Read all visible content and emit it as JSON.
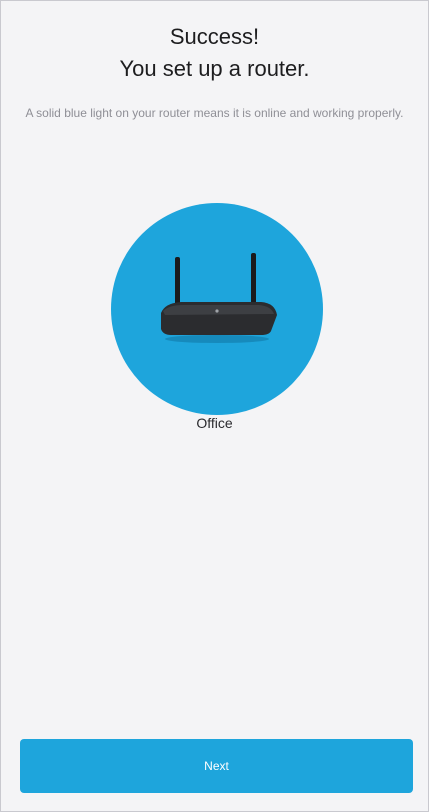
{
  "header": {
    "title": "Success!",
    "subtitle": "You set up a router."
  },
  "description": "A solid blue light on your router means it is online and working properly.",
  "device": {
    "name": "Office",
    "icon": "router-icon",
    "circle_color": "#1ea5dc"
  },
  "actions": {
    "next_label": "Next"
  },
  "colors": {
    "accent": "#1ea5dc",
    "background": "#f4f4f6"
  }
}
